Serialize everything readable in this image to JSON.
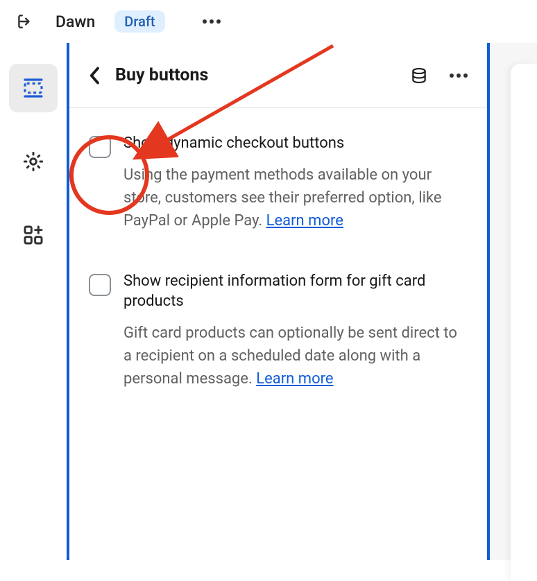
{
  "topbar": {
    "theme_name": "Dawn",
    "status_badge": "Draft"
  },
  "sidebar": {
    "items": [
      {
        "name": "sections",
        "active": true
      },
      {
        "name": "settings",
        "active": false
      },
      {
        "name": "apps",
        "active": false
      }
    ]
  },
  "panel": {
    "title": "Buy buttons",
    "settings": [
      {
        "id": "dynamic_checkout",
        "label": "Show dynamic checkout buttons",
        "description": "Using the payment methods available on your store, customers see their preferred option, like PayPal or Apple Pay.",
        "learn_more": "Learn more",
        "checked": false
      },
      {
        "id": "gift_card_recipient",
        "label": "Show recipient information form for gift card products",
        "description": "Gift card products can optionally be sent direct to a recipient on a scheduled date along with a personal message.",
        "learn_more": "Learn more",
        "checked": false
      }
    ]
  }
}
